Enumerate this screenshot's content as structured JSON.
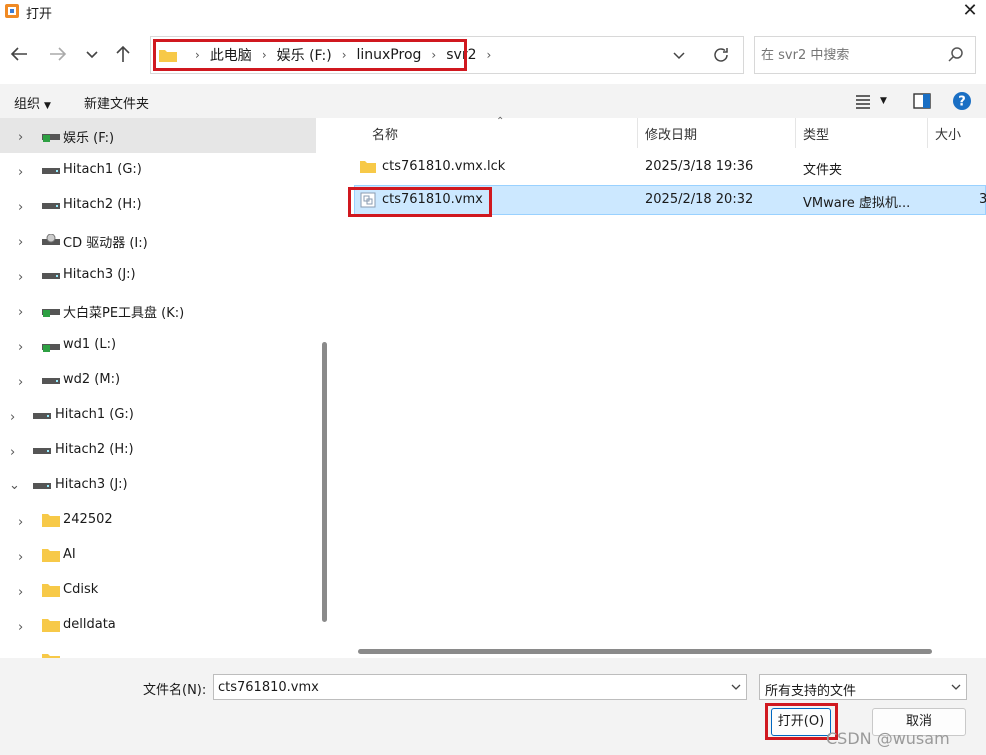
{
  "window": {
    "title": "打开",
    "close_label": "✕"
  },
  "address": {
    "breadcrumbs": [
      "此电脑",
      "娱乐 (F:)",
      "linuxProg",
      "svr2"
    ]
  },
  "search": {
    "placeholder": "在 svr2 中搜索"
  },
  "toolbar": {
    "organize": "组织",
    "new_folder": "新建文件夹"
  },
  "nav": {
    "items": [
      {
        "label": "娱乐 (F:)",
        "icon": "drive-green-icon",
        "selected": true
      },
      {
        "label": "Hitach1 (G:)",
        "icon": "drive-icon"
      },
      {
        "label": "Hitach2 (H:)",
        "icon": "drive-icon"
      },
      {
        "label": "CD 驱动器 (I:)",
        "icon": "cd-drive-icon"
      },
      {
        "label": "Hitach3 (J:)",
        "icon": "drive-icon"
      },
      {
        "label": "大白菜PE工具盘 (K:)",
        "icon": "drive-green-icon"
      },
      {
        "label": "wd1 (L:)",
        "icon": "drive-green-icon"
      },
      {
        "label": "wd2 (M:)",
        "icon": "drive-icon"
      },
      {
        "label": "Hitach1 (G:)",
        "icon": "drive-icon"
      },
      {
        "label": "Hitach2 (H:)",
        "icon": "drive-icon"
      },
      {
        "label": "Hitach3 (J:)",
        "icon": "drive-icon",
        "expanded": true
      },
      {
        "label": "242502",
        "icon": "folder-icon"
      },
      {
        "label": "AI",
        "icon": "folder-icon"
      },
      {
        "label": "Cdisk",
        "icon": "folder-icon"
      },
      {
        "label": "delldata",
        "icon": "folder-icon"
      }
    ]
  },
  "files": {
    "columns": [
      "名称",
      "修改日期",
      "类型",
      "大小"
    ],
    "rows": [
      {
        "name": "cts761810.vmx.lck",
        "date": "2025/3/18 19:36",
        "type": "文件夹",
        "size": "",
        "icon": "folder-icon"
      },
      {
        "name": "cts761810.vmx",
        "date": "2025/2/18 20:32",
        "type": "VMware 虚拟机...",
        "size": "3",
        "icon": "vmx-file-icon",
        "selected": true
      }
    ]
  },
  "bottom": {
    "filename_label": "文件名(N):",
    "filename_value": "cts761810.vmx",
    "filetype": "所有支持的文件",
    "open_button": "打开(O)",
    "cancel_button": "取消"
  },
  "watermark": "CSDN @wusam",
  "colors": {
    "highlight": "#d0181f",
    "selection": "#cce8ff",
    "accent": "#0067c0"
  }
}
